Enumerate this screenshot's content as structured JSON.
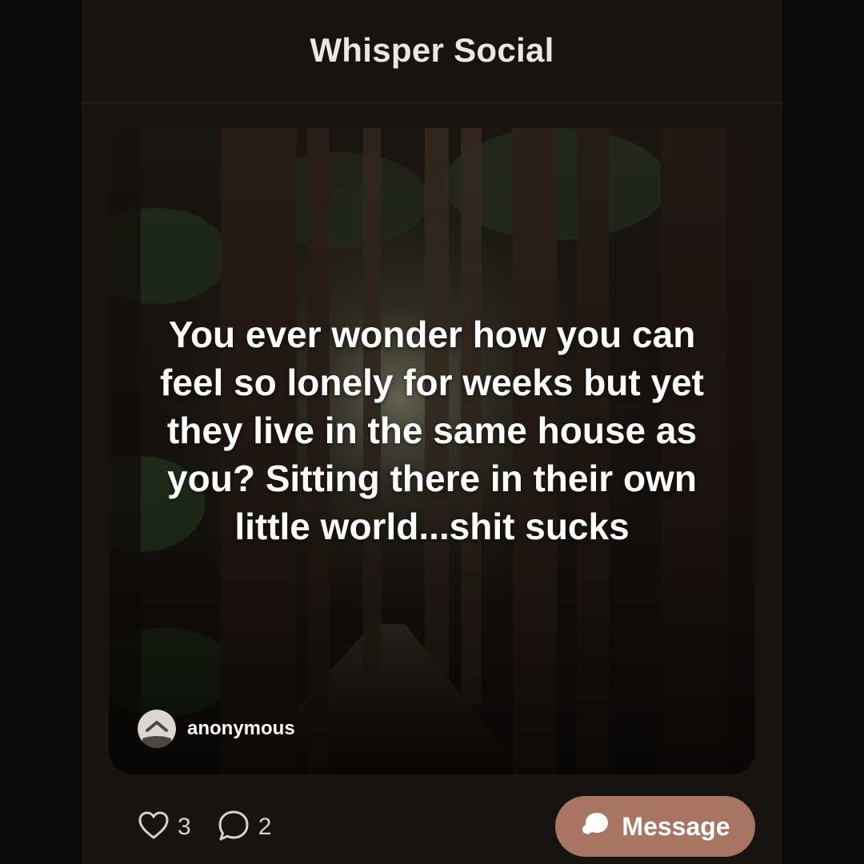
{
  "header": {
    "title": "Whisper Social"
  },
  "post": {
    "text": "You ever wonder how you can feel so lonely for weeks but yet they live in the same house as you? Sitting there in their own little world...shit sucks",
    "background_image": "dark-redwood-forest-path",
    "author": {
      "name": "anonymous",
      "avatar_icon": "anonymous-mask-icon"
    }
  },
  "actions": {
    "likes": {
      "icon": "heart-icon",
      "count": "3"
    },
    "comments": {
      "icon": "comment-icon",
      "count": "2"
    },
    "message_button": {
      "icon": "chat-bubbles-icon",
      "label": "Message"
    }
  },
  "colors": {
    "page_background": "#0c0a09",
    "app_background": "#171311",
    "accent": "#a87562",
    "text_primary": "#ffffff"
  }
}
